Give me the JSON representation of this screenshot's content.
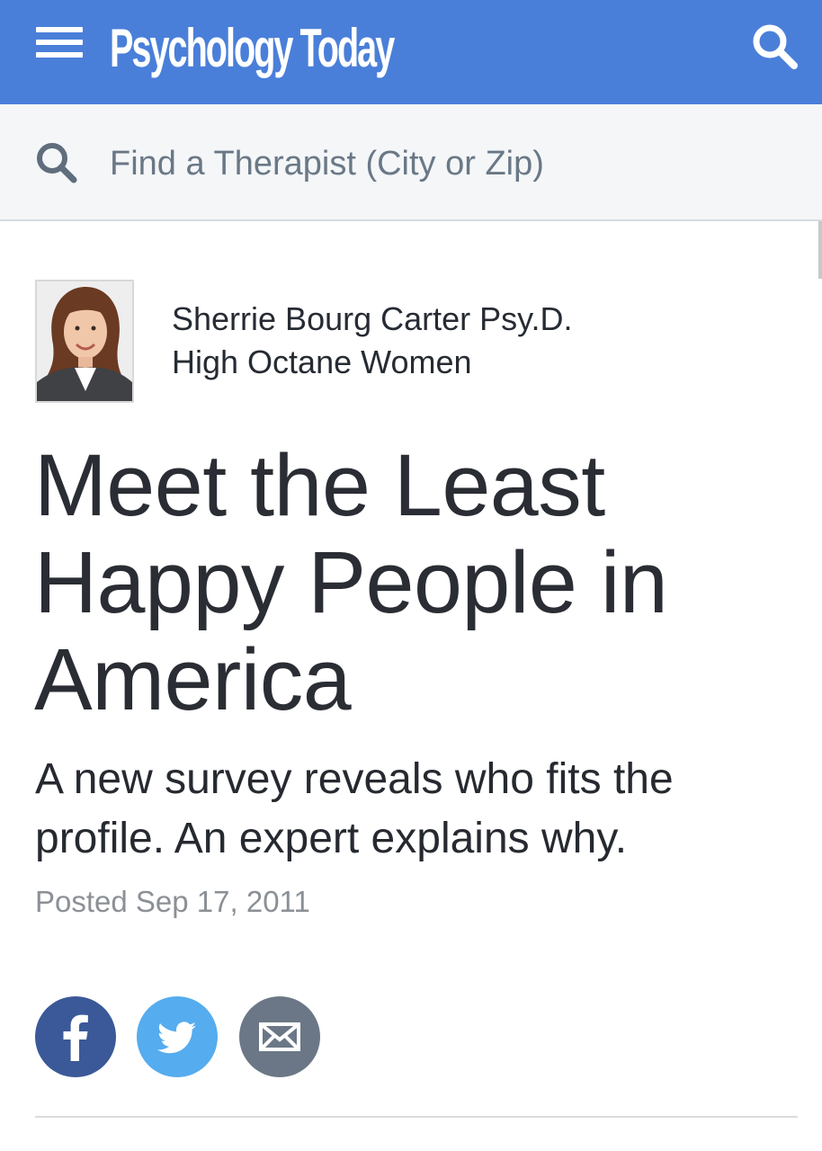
{
  "header": {
    "logo_text": "Psychology Today",
    "brand_color": "#4a7fd9",
    "menu_icon": "hamburger-menu-icon",
    "search_icon": "search-icon"
  },
  "therapist_search": {
    "placeholder": "Find a Therapist (City or Zip)",
    "value": "",
    "icon": "search-icon"
  },
  "author": {
    "name": "Sherrie Bourg Carter Psy.D.",
    "blog": "High Octane Women",
    "photo_icon": "author-photo"
  },
  "article": {
    "title": "Meet the Least Happy People in America",
    "subtitle": "A new survey reveals who fits the profile. An expert explains why.",
    "posted": "Posted Sep 17, 2011"
  },
  "share": {
    "facebook": {
      "icon": "facebook-icon",
      "color": "#3b5998"
    },
    "twitter": {
      "icon": "twitter-icon",
      "color": "#55acee"
    },
    "email": {
      "icon": "email-icon",
      "color": "#6b7786"
    }
  }
}
